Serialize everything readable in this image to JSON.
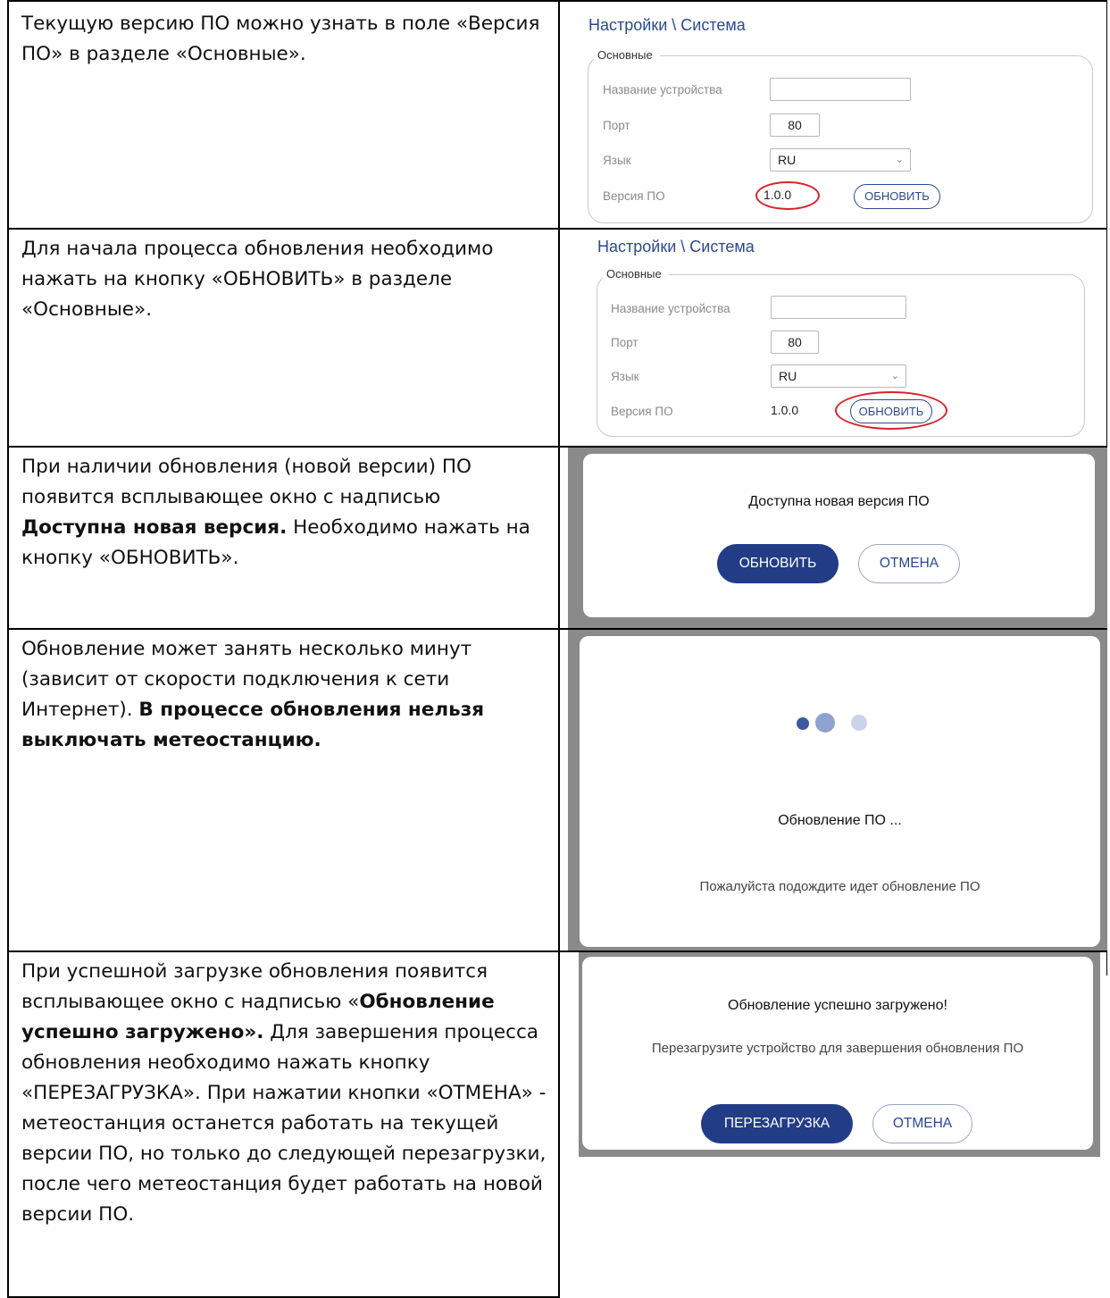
{
  "rows": [
    {
      "text": "Текущую версию ПО можно узнать в поле «Версия ПО» в разделе «Основные»."
    },
    {
      "text": "Для начала процесса обновления необходимо нажать на кнопку «ОБНОВИТЬ» в разделе «Основные»."
    },
    {
      "text_parts": [
        "При наличии обновления (новой версии) ПО появится всплывающее окно с надписью ",
        "Доступна новая версия.",
        " Необходимо нажать на кнопку «ОБНОВИТЬ»."
      ]
    },
    {
      "text_parts": [
        "Обновление может занять несколько минут (зависит от скорости подключения к сети Интернет). ",
        "В процессе обновления нельзя выключать метеостанцию."
      ]
    },
    {
      "text_parts": [
        "При успешной загрузке обновления появится всплывающее окно с надписью «",
        "Обновление успешно загружено».",
        " Для завершения процесса обновления необходимо нажать кнопку «ПЕРЕЗАГРУЗКА». При нажатии кнопки «ОТМЕНА» - метеостанция останется работать на текущей версии ПО, но только до следующей перезагрузки, после чего метеостанция будет работать на новой версии ПО."
      ]
    }
  ],
  "settings": {
    "breadcrumb": "Настройки \\ Система",
    "section": "Основные",
    "device_name_label": "Название устройства",
    "device_name_value": "",
    "port_label": "Порт",
    "port_value": "80",
    "language_label": "Язык",
    "language_value": "RU",
    "version_label": "Версия ПО",
    "version_value": "1.0.0",
    "update_button": "ОБНОВИТЬ"
  },
  "dialog_new_version": {
    "title": "Доступна новая версия ПО",
    "update_button": "ОБНОВИТЬ",
    "cancel_button": "ОТМЕНА"
  },
  "dialog_updating": {
    "title": "Обновление ПО ...",
    "message": "Пожалуйста подождите идет обновление ПО"
  },
  "dialog_success": {
    "title": "Обновление успешно загружено!",
    "message": "Перезагрузите устройство для завершения обновления ПО",
    "reboot_button": "ПЕРЕЗАГРУЗКА",
    "cancel_button": "ОТМЕНА"
  },
  "colors": {
    "accent": "#233c86",
    "highlight": "#d9232d",
    "overlay": "#8a8a8a"
  }
}
